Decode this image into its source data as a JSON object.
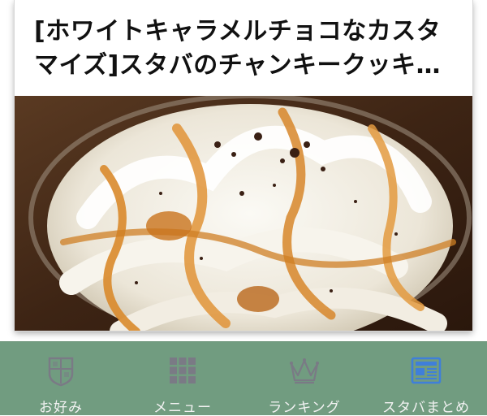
{
  "article": {
    "title": "[ホワイトキャラメルチョコなカスタマイズ]スタバのチャンキークッキ…"
  },
  "tabbar": {
    "tabs": [
      {
        "label": "お好み",
        "icon": "shield-icon"
      },
      {
        "label": "メニュー",
        "icon": "grid-menu-icon"
      },
      {
        "label": "ランキング",
        "icon": "crown-icon"
      },
      {
        "label": "スタバまとめ",
        "icon": "newspaper-icon",
        "active": true
      }
    ],
    "active_color": "#3f7fd9",
    "inactive_icon_color": "#7a7a85",
    "background": "#719c80"
  }
}
